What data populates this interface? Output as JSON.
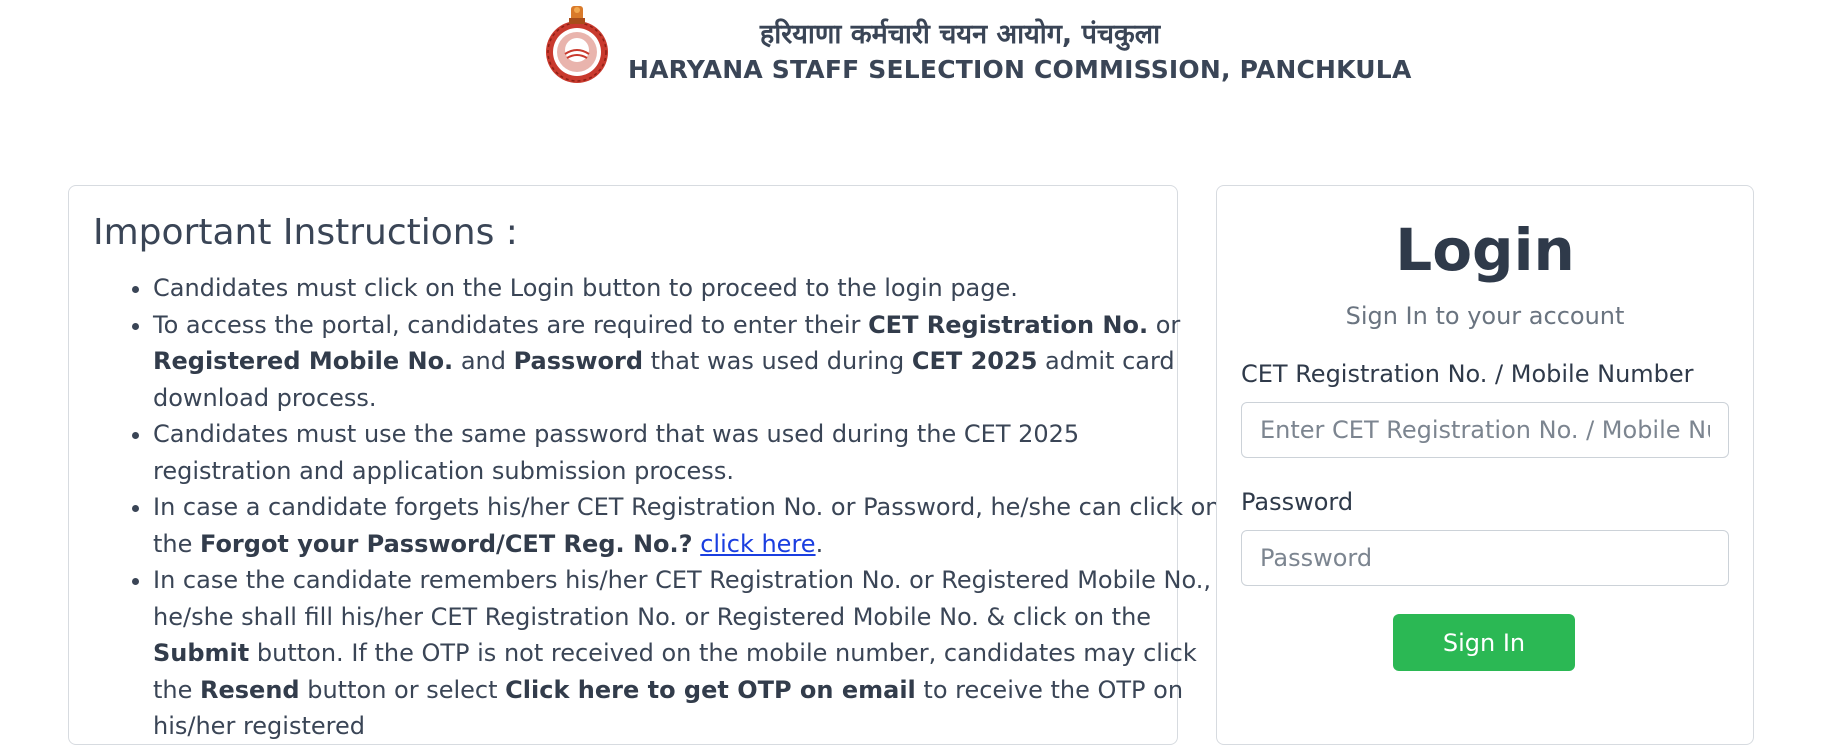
{
  "header": {
    "title_hindi": "हरियाणा कर्मचारी चयन आयोग, पंचकुला",
    "title_english": "HARYANA STAFF SELECTION COMMISSION, PANCHKULA",
    "emblem_icon": "haryana-emblem-icon"
  },
  "instructions": {
    "title": "Important Instructions :",
    "items": [
      {
        "t1": "Candidates must click on the Login button to proceed to the login page."
      },
      {
        "t1": "To access the portal, candidates are required to enter their ",
        "b1": "CET Registration No.",
        "t2": " or ",
        "b2": "Registered Mobile No.",
        "t3": " and ",
        "b3": "Password",
        "t4": " that was used during ",
        "b4": "CET 2025",
        "t5": " admit card download process."
      },
      {
        "t1": "Candidates must use the same password that was used during the CET 2025 registration and application submission process."
      },
      {
        "t1": "In case a candidate forgets his/her CET Registration No. or Password, he/she can click on the ",
        "b1": "Forgot your Password/CET Reg. No.?",
        "t2": " ",
        "link": "click here",
        "t3": "."
      },
      {
        "t1": "In case the candidate remembers his/her CET Registration No. or Registered Mobile No., he/she shall fill his/her CET Registration No. or Registered Mobile No. & click on the ",
        "b1": "Submit",
        "t2": " button. If the OTP is not received on the mobile number, candidates may click the ",
        "b2": "Resend",
        "t3": " button or select ",
        "b3": "Click here to get OTP on email",
        "t4": " to receive the OTP on his/her registered"
      }
    ]
  },
  "login": {
    "title": "Login",
    "subtitle": "Sign In to your account",
    "reg_label": "CET Registration No. / Mobile Number",
    "reg_placeholder": "Enter CET Registration No. / Mobile Number",
    "password_label": "Password",
    "password_placeholder": "Password",
    "signin_label": "Sign In",
    "button_color": "#2bb854"
  },
  "colors": {
    "text": "#3a4556",
    "link": "#1a3ee0",
    "border": "#d7dbe0"
  }
}
